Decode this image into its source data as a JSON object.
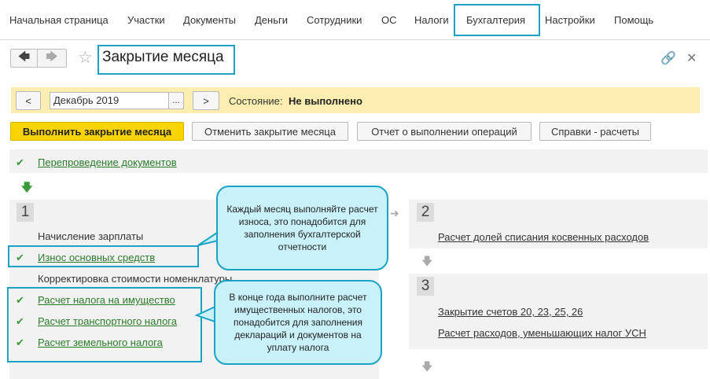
{
  "menu": {
    "items": [
      "Начальная страница",
      "Участки",
      "Документы",
      "Деньги",
      "Сотрудники",
      "ОС",
      "Налоги",
      "Бухгалтерия",
      "Настройки",
      "Помощь"
    ]
  },
  "header": {
    "title": "Закрытие месяца"
  },
  "period": {
    "prev_label": "<",
    "next_label": ">",
    "value": "Декабрь 2019",
    "picker_label": "...",
    "status_label": "Состояние:",
    "status_value": "Не выполнено"
  },
  "actions": {
    "run": "Выполнить закрытие месяца",
    "cancel": "Отменить закрытие месяца",
    "report": "Отчет о выполнении операций",
    "references": "Справки - расчеты"
  },
  "prelude": {
    "label": "Перепроведение документов"
  },
  "step1": {
    "number": "1",
    "items": [
      "Начисление зарплаты",
      "Износ основных средств",
      "Корректировка стоимости номенклатуры",
      "Расчет налога на имущество",
      "Расчет транспортного налога",
      "Расчет земельного налога"
    ]
  },
  "step2": {
    "number": "2",
    "items": [
      "Расчет долей списания косвенных расходов"
    ]
  },
  "step3": {
    "number": "3",
    "items": [
      "Закрытие счетов 20, 23, 25, 26",
      "Расчет расходов, уменьшающих налог УСН"
    ]
  },
  "callouts": {
    "top": "Каждый месяц выполняйте расчет износа, это понадобится для заполнения бухгалтерской отчетности",
    "bottom": "В конце года выполните расчет имущественных налогов, это понадобится для заполнения деклараций и документов на уплату налога"
  },
  "colors": {
    "accent": "#1aa3c4",
    "primary_button": "#fad400",
    "status_bar": "#fbeeb0",
    "done_link": "#2b7a2b"
  }
}
